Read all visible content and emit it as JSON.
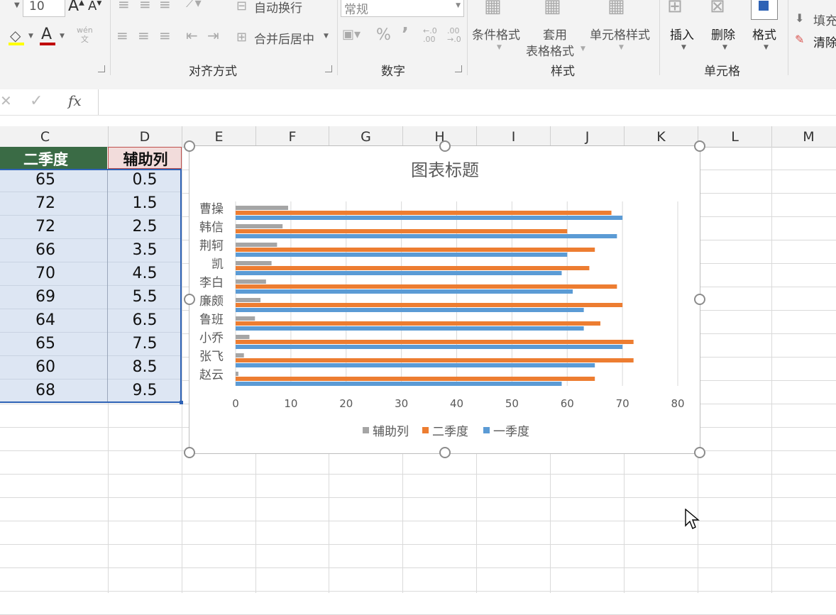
{
  "ribbon": {
    "font_size": "10",
    "wrap_text": "自动换行",
    "merge_center": "合并后居中",
    "number_format": "常规",
    "percent": "%",
    "comma": "’",
    "dec_inc": "←.0\n.00",
    "dec_dec": ".00\n→.0",
    "cond_format": "条件格式",
    "table_format_1": "套用",
    "table_format_2": "表格格式",
    "cell_style": "单元格样式",
    "insert": "插入",
    "delete": "删除",
    "format": "格式",
    "fill": "填充",
    "clear": "清除",
    "wen": "wén\n文",
    "groups": {
      "alignment": "对齐方式",
      "number": "数字",
      "styles": "样式",
      "cells": "单元格"
    }
  },
  "formula_bar": {
    "fx": "fx",
    "value": ""
  },
  "columns": [
    "C",
    "D",
    "E",
    "F",
    "G",
    "H",
    "I",
    "J",
    "K",
    "L",
    "M"
  ],
  "table": {
    "headers": [
      "二季度",
      "辅助列"
    ],
    "rows": [
      [
        "65",
        "0.5"
      ],
      [
        "72",
        "1.5"
      ],
      [
        "72",
        "2.5"
      ],
      [
        "66",
        "3.5"
      ],
      [
        "70",
        "4.5"
      ],
      [
        "69",
        "5.5"
      ],
      [
        "64",
        "6.5"
      ],
      [
        "65",
        "7.5"
      ],
      [
        "60",
        "8.5"
      ],
      [
        "68",
        "9.5"
      ]
    ]
  },
  "colors": {
    "header_green": "#3a6b45",
    "header_pink": "#f2dcdb",
    "selection_fill": "#dde6f3",
    "selection_border": "#2e62b5",
    "series_gray": "#a5a5a5",
    "series_orange": "#ed7d31",
    "series_blue": "#5b9bd5"
  },
  "chart_data": {
    "type": "bar",
    "title": "图表标题",
    "categories": [
      "曹操",
      "韩信",
      "荆轲",
      "凯",
      "李白",
      "廉颇",
      "鲁班",
      "小乔",
      "张飞",
      "赵云"
    ],
    "series": [
      {
        "name": "辅助列",
        "values": [
          9.5,
          8.5,
          7.5,
          6.5,
          5.5,
          4.5,
          3.5,
          2.5,
          1.5,
          0.5
        ]
      },
      {
        "name": "二季度",
        "values": [
          68,
          60,
          65,
          64,
          69,
          70,
          66,
          72,
          72,
          65
        ]
      },
      {
        "name": "一季度",
        "values": [
          70,
          69,
          60,
          59,
          61,
          63,
          63,
          70,
          65,
          59
        ]
      }
    ],
    "xlim": [
      0,
      80
    ],
    "ticks": [
      "0",
      "10",
      "20",
      "30",
      "40",
      "50",
      "60",
      "70",
      "80"
    ],
    "grid": true,
    "legend": "bottom"
  }
}
